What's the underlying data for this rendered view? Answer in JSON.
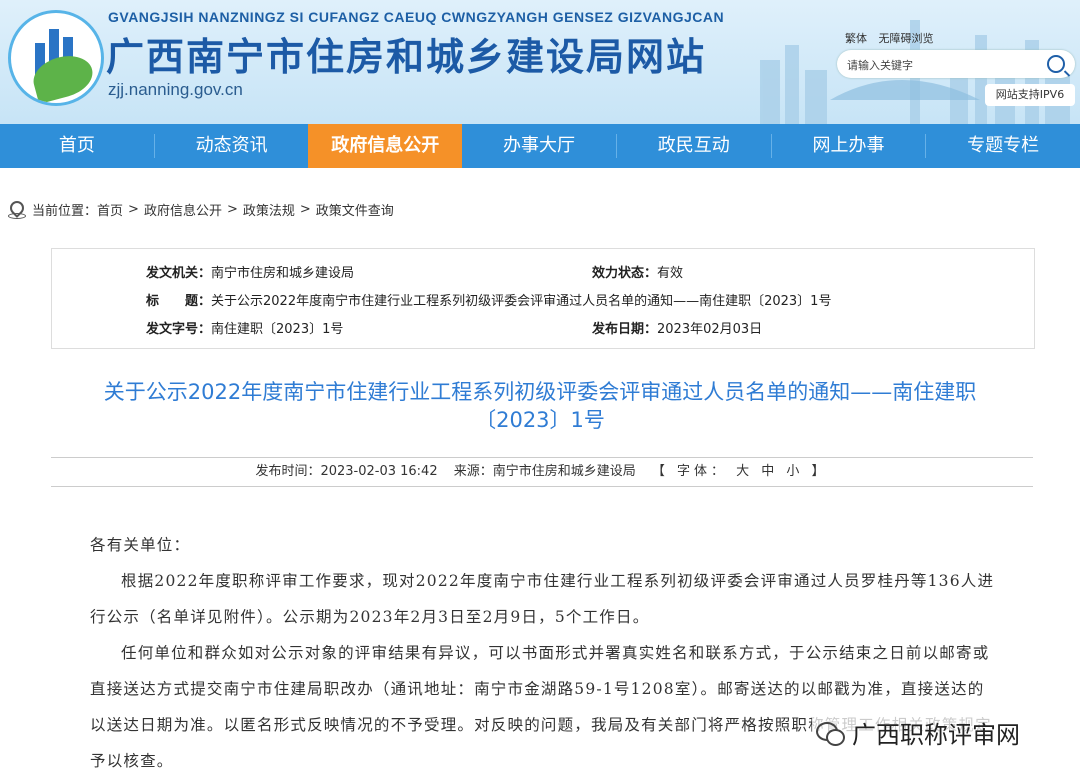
{
  "header": {
    "pinyin": "GVANGJSIH NANZNINGZ SI CUFANGZ CAEUQ CWNGZYANGH GENSEZ GIZVANGJCAN",
    "title": "广西南宁市住房和城乡建设局网站",
    "domain": "zjj.nanning.gov.cn",
    "links": [
      "繁体",
      "无障碍浏览"
    ],
    "search_placeholder": "请输入关键字",
    "ipv6": "网站支持IPV6"
  },
  "nav": {
    "items": [
      "首页",
      "动态资讯",
      "政府信息公开",
      "办事大厅",
      "政民互动",
      "网上办事",
      "专题专栏"
    ],
    "active_index": 2,
    "colors": {
      "bar": "#2f8fd9",
      "active": "#f59128"
    }
  },
  "breadcrumb": {
    "label": "当前位置：",
    "items": [
      "首页",
      "政府信息公开",
      "政策法规",
      "政策文件查询"
    ]
  },
  "info": {
    "issuer_label": "发文机关：",
    "issuer": "南宁市住房和城乡建设局",
    "status_label": "效力状态：",
    "status": "有效",
    "title_label": "标　　题：",
    "title": "关于公示2022年度南宁市住建行业工程系列初级评委会评审通过人员名单的通知——南住建职〔2023〕1号",
    "docno_label": "发文字号：",
    "docno": "南住建职〔2023〕1号",
    "date_label": "发布日期：",
    "date": "2023年02月03日"
  },
  "article": {
    "title_line1": "关于公示2022年度南宁市住建行业工程系列初级评委会评审通过人员名单的通知——南住建职",
    "title_line2": "〔2023〕1号",
    "meta_time": "发布时间：2023-02-03 16:42",
    "meta_source": "来源：南宁市住房和城乡建设局",
    "meta_font": "【 字体： 大 中 小 】",
    "salutation": "各有关单位：",
    "para1": "根据2022年度职称评审工作要求，现对2022年度南宁市住建行业工程系列初级评委会评审通过人员罗桂丹等136人进行公示（名单详见附件）。公示期为2023年2月3日至2月9日，5个工作日。",
    "para2": "任何单位和群众如对公示对象的评审结果有异议，可以书面形式并署真实姓名和联系方式，于公示结束之日前以邮寄或直接送达方式提交南宁市住建局职改办（通讯地址：南宁市金湖路59-1号1208室）。邮寄送达的以邮戳为准，直接送达的以送达日期为准。以匿名形式反映情况的不予受理。对反映的问题，我局及有关部门将严格按照职称管理工作相关政策规定予以核查。"
  },
  "watermark": {
    "icon": "wechat-icon",
    "text": "广西职称评审网"
  }
}
